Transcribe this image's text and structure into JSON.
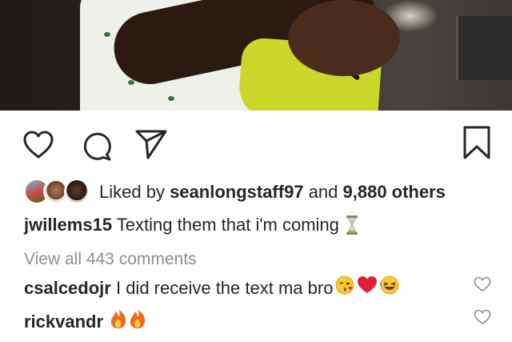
{
  "post": {
    "likes": {
      "prefix": "Liked by ",
      "liker": "seanlongstaff97",
      "and_text": " and ",
      "others": "9,880 others"
    },
    "caption": {
      "author": "jwillems15",
      "text": "Texting them that i'm coming",
      "emoji": "hourglass-icon"
    },
    "view_all_comments": "View all 443 comments",
    "comments": [
      {
        "author": "csalcedojr",
        "text": "I did receive the text ma bro",
        "emojis": [
          "kissing-face-icon",
          "red-heart-icon",
          "laughing-face-icon"
        ]
      },
      {
        "author": "rickvandr",
        "text": "",
        "emojis": [
          "fire-icon",
          "fire-icon"
        ]
      }
    ]
  },
  "actions": [
    "like-icon",
    "comment-icon",
    "share-icon",
    "save-icon"
  ],
  "colors": {
    "text": "#262626",
    "muted": "#8e8e8e",
    "bag": "#c9d62a",
    "heart": "#e0203a",
    "fire": "#f26a1b"
  }
}
